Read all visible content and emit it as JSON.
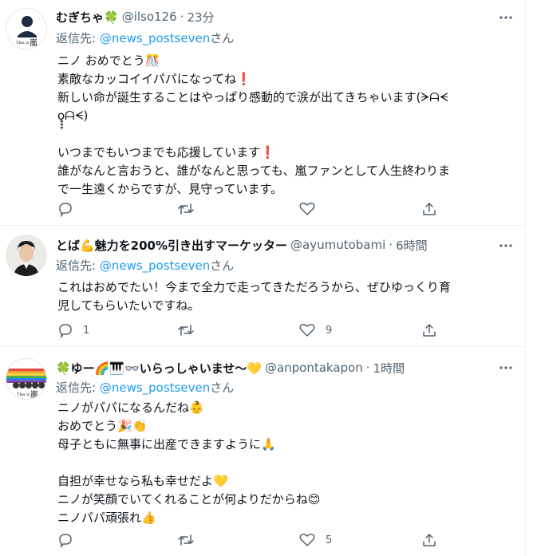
{
  "tweets": [
    {
      "name": "むぎちゃ🍀",
      "handle": "@ilso126",
      "sep": "·",
      "time": "23分",
      "reply_prefix": "返信先: ",
      "reply_mention": "@news_postseven",
      "reply_suffix": "さん",
      "avatar_caption": "This is 嵐",
      "lines": [
        "ニノ おめでとう🎊",
        "素敵なカッコイイパパになってね❗",
        "新しい命が誕生することはやっぱり感動的で涙が出てきちゃいます(ᗒᗩᗕ",
        "ọ̥̥̥ᗩᗕ)",
        "",
        "いつまでもいつまでも応援しています❗",
        "誰がなんと言おうと、誰がなんと思っても、嵐ファンとして人生終わりま",
        "で一生遠くからですが、見守っています。"
      ],
      "counts": {
        "reply": "",
        "retweet": "",
        "like": ""
      }
    },
    {
      "name": "とば💪魅力を200%引き出すマーケッター",
      "handle": "@ayumutobami",
      "sep": "·",
      "time": "6時間",
      "reply_prefix": "返信先: ",
      "reply_mention": "@news_postseven",
      "reply_suffix": "さん",
      "lines": [
        "これはおめでたい！今まで全力で走ってきただろうから、ぜひゆっくり育",
        "児してもらいたいですね。"
      ],
      "counts": {
        "reply": "1",
        "retweet": "",
        "like": "9"
      }
    },
    {
      "name": "🍀ゆー🌈🎹👓いらっしゃいませ〜💛",
      "handle": "@anpontakapon",
      "sep": "·",
      "time": "1時間",
      "reply_prefix": "返信先: ",
      "reply_mention": "@news_postseven",
      "reply_suffix": "さん",
      "avatar_caption": "This is 嵐",
      "lines": [
        "ニノがパパになるんだね👶",
        "おめでとう🎉👏",
        "母子ともに無事に出産できますように🙏",
        "",
        "自担が幸せなら私も幸せだよ💛",
        "ニノが笑顔でいてくれることが何よりだからね😊",
        "ニノパパ頑張れ👍"
      ],
      "counts": {
        "reply": "",
        "retweet": "",
        "like": "5"
      }
    }
  ],
  "icons": {
    "more": "more-horizontal-icon",
    "reply": "reply-bubble-icon",
    "retweet": "retweet-icon",
    "like": "heart-outline-icon",
    "share": "share-upload-icon"
  },
  "colors": {
    "link": "#1d9bf0",
    "secondary": "#536471",
    "text": "#0f1419",
    "divider": "#eff3f4"
  }
}
